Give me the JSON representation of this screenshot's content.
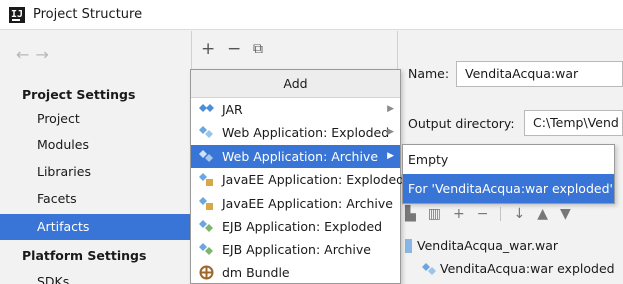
{
  "window": {
    "title": "Project Structure"
  },
  "nav": {
    "back": "←",
    "forward": "→"
  },
  "sidebar": {
    "project_settings_header": "Project Settings",
    "project_items": [
      "Project",
      "Modules",
      "Libraries",
      "Facets",
      "Artifacts"
    ],
    "selected_item": "Artifacts",
    "platform_settings_header": "Platform Settings",
    "platform_items": [
      "SDKs"
    ]
  },
  "toolbar": {
    "add": "+",
    "remove": "−",
    "copy": "⧉"
  },
  "add_menu": {
    "header": "Add",
    "items": [
      {
        "label": "JAR",
        "has_submenu": true,
        "icon": "jar-diamond-icon"
      },
      {
        "label": "Web Application: Exploded",
        "has_submenu": true,
        "icon": "web-app-icon"
      },
      {
        "label": "Web Application: Archive",
        "has_submenu": true,
        "icon": "web-app-icon",
        "highlighted": true
      },
      {
        "label": "JavaEE Application: Exploded",
        "icon": "javaee-icon"
      },
      {
        "label": "JavaEE Application: Archive",
        "icon": "javaee-icon"
      },
      {
        "label": "EJB Application: Exploded",
        "icon": "ejb-icon"
      },
      {
        "label": "EJB Application: Archive",
        "icon": "ejb-icon"
      },
      {
        "label": "dm Bundle",
        "icon": "bundle-icon"
      }
    ]
  },
  "submenu": {
    "items": [
      "Empty",
      "For 'VenditaAcqua:war exploded'"
    ],
    "highlighted_index": 1
  },
  "artifact": {
    "name_label": "Name:",
    "name_value": "VenditaAcqua:war",
    "output_label": "Output directory:",
    "output_value": "C:\\Temp\\Vend"
  },
  "layout_tree": {
    "root": "VenditaAcqua_war.war",
    "child": "VenditaAcqua:war exploded"
  },
  "colors": {
    "selection": "#3875d6",
    "background": "#f2f2f2"
  }
}
